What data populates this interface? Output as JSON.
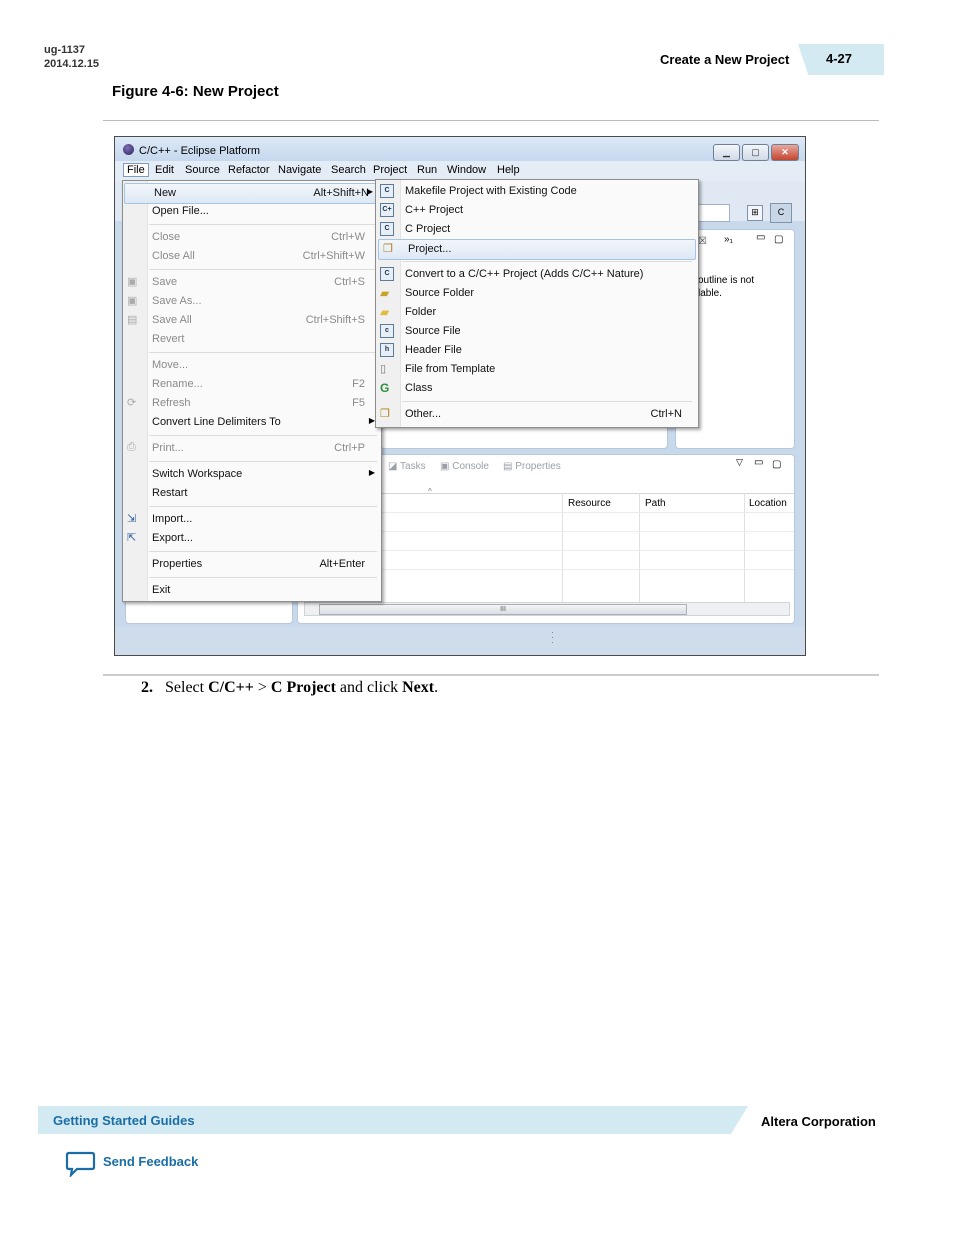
{
  "header": {
    "doc_id": "ug-1137",
    "doc_date": "2014.12.15",
    "section_title": "Create a New Project",
    "page_number": "4-27"
  },
  "figure_caption": "Figure 4-6: New Project",
  "screenshot": {
    "window_title": "C/C++ - Eclipse Platform",
    "menubar": [
      "File",
      "Edit",
      "Source",
      "Refactor",
      "Navigate",
      "Search",
      "Project",
      "Run",
      "Window",
      "Help"
    ],
    "file_menu": [
      {
        "label": "New",
        "shortcut": "Alt+Shift+N",
        "submenu": true,
        "enabled": true
      },
      {
        "label": "Open File...",
        "shortcut": "",
        "enabled": true
      },
      {
        "label": "Close",
        "shortcut": "Ctrl+W",
        "enabled": false
      },
      {
        "label": "Close All",
        "shortcut": "Ctrl+Shift+W",
        "enabled": false
      },
      {
        "label": "Save",
        "shortcut": "Ctrl+S",
        "enabled": false
      },
      {
        "label": "Save As...",
        "shortcut": "",
        "enabled": false
      },
      {
        "label": "Save All",
        "shortcut": "Ctrl+Shift+S",
        "enabled": false
      },
      {
        "label": "Revert",
        "shortcut": "",
        "enabled": false
      },
      {
        "label": "Move...",
        "shortcut": "",
        "enabled": false
      },
      {
        "label": "Rename...",
        "shortcut": "F2",
        "enabled": false
      },
      {
        "label": "Refresh",
        "shortcut": "F5",
        "enabled": false
      },
      {
        "label": "Convert Line Delimiters To",
        "shortcut": "",
        "submenu": true,
        "enabled": true
      },
      {
        "label": "Print...",
        "shortcut": "Ctrl+P",
        "enabled": false
      },
      {
        "label": "Switch Workspace",
        "shortcut": "",
        "submenu": true,
        "enabled": true
      },
      {
        "label": "Restart",
        "shortcut": "",
        "enabled": true
      },
      {
        "label": "Import...",
        "shortcut": "",
        "enabled": true
      },
      {
        "label": "Export...",
        "shortcut": "",
        "enabled": true
      },
      {
        "label": "Properties",
        "shortcut": "Alt+Enter",
        "enabled": true
      },
      {
        "label": "Exit",
        "shortcut": "",
        "enabled": true
      }
    ],
    "new_menu": [
      {
        "label": "Makefile Project with Existing Code",
        "shortcut": ""
      },
      {
        "label": "C++ Project",
        "shortcut": ""
      },
      {
        "label": "C Project",
        "shortcut": ""
      },
      {
        "label": "Project...",
        "shortcut": ""
      },
      {
        "label": "Convert to a C/C++ Project (Adds C/C++ Nature)",
        "shortcut": ""
      },
      {
        "label": "Source Folder",
        "shortcut": ""
      },
      {
        "label": "Folder",
        "shortcut": ""
      },
      {
        "label": "Source File",
        "shortcut": ""
      },
      {
        "label": "Header File",
        "shortcut": ""
      },
      {
        "label": "File from Template",
        "shortcut": ""
      },
      {
        "label": "Class",
        "shortcut": ""
      },
      {
        "label": "Other...",
        "shortcut": "Ctrl+N"
      }
    ],
    "outline_text_1": "outline is not",
    "outline_text_2": "lable.",
    "bottom_tabs": [
      "Tasks",
      "Console",
      "Properties"
    ],
    "table_columns": [
      "Resource",
      "Path",
      "Location"
    ],
    "scrollbar_grip": "III"
  },
  "step": {
    "number": "2.",
    "text_1": "Select",
    "bold_1": "C/C++",
    "sep": ">",
    "bold_2": "C Project",
    "text_2": "and click",
    "bold_3": "Next",
    "end": "."
  },
  "footer": {
    "guide_link": "Getting Started Guides",
    "company": "Altera Corporation",
    "feedback": "Send Feedback"
  }
}
